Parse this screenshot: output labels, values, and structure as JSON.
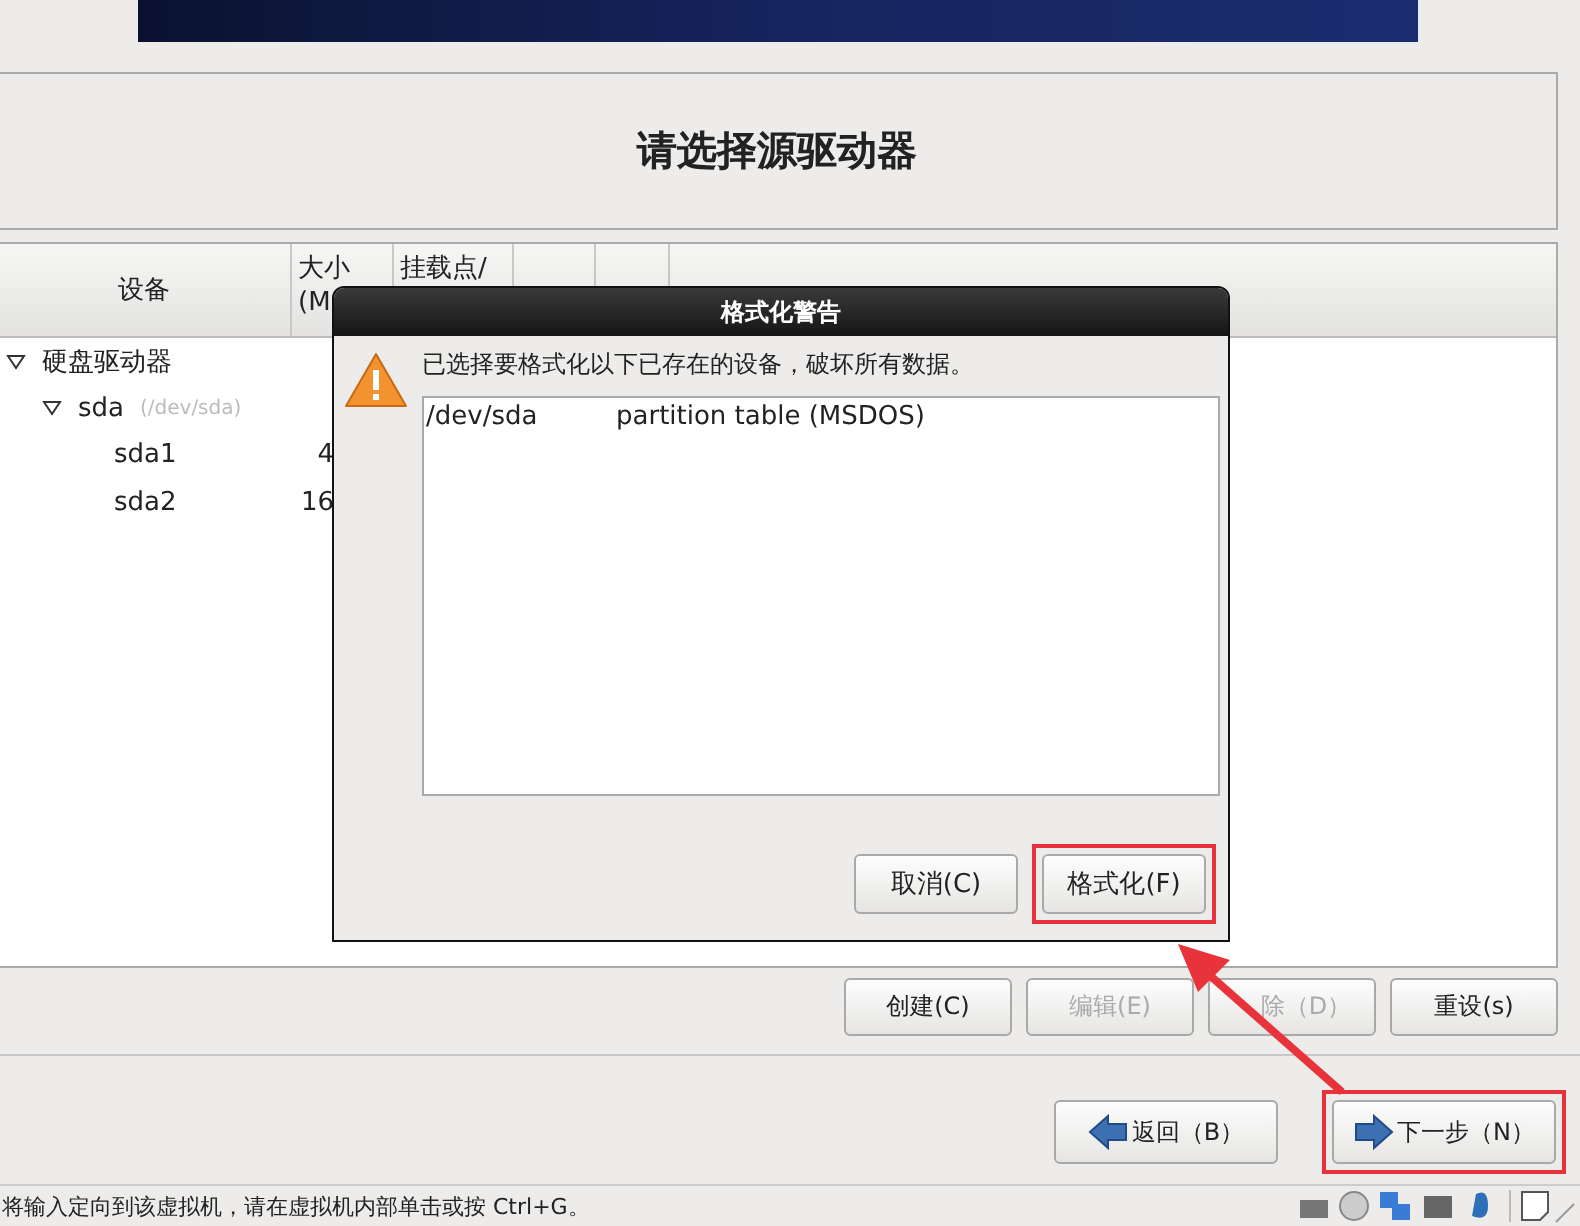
{
  "title": "请选择源驱动器",
  "table": {
    "columns": [
      "设备",
      "大小 (M",
      "挂载点/"
    ],
    "tree": [
      {
        "label": "硬盘驱动器",
        "expanded": true,
        "children": [
          {
            "label": "sda",
            "path": "(/dev/sda)",
            "expanded": true,
            "children": [
              {
                "label": "sda1",
                "size": "4"
              },
              {
                "label": "sda2",
                "size": "16"
              }
            ]
          }
        ]
      }
    ]
  },
  "dialog": {
    "title": "格式化警告",
    "message": "已选择要格式化以下已存在的设备，破坏所有数据。",
    "entries": [
      {
        "device": "/dev/sda",
        "description": "partition table (MSDOS)"
      }
    ],
    "buttons": [
      {
        "label": "取消(C)",
        "highlighted": false
      },
      {
        "label": "格式化(F)",
        "highlighted": true
      }
    ]
  },
  "actions": [
    {
      "label": "创建(C)",
      "disabled": false
    },
    {
      "label": "编辑(E)",
      "disabled": true
    },
    {
      "label": "除（D）",
      "disabled": true
    },
    {
      "label": "重设(s)",
      "disabled": false
    }
  ],
  "nav": [
    {
      "label": "返回（B）",
      "kind": "back",
      "highlighted": false
    },
    {
      "label": "下一步（N）",
      "kind": "next",
      "highlighted": true
    }
  ],
  "status_bar": {
    "text": "将输入定向到该虚拟机，请在虚拟机内部单击或按 Ctrl+G。"
  }
}
